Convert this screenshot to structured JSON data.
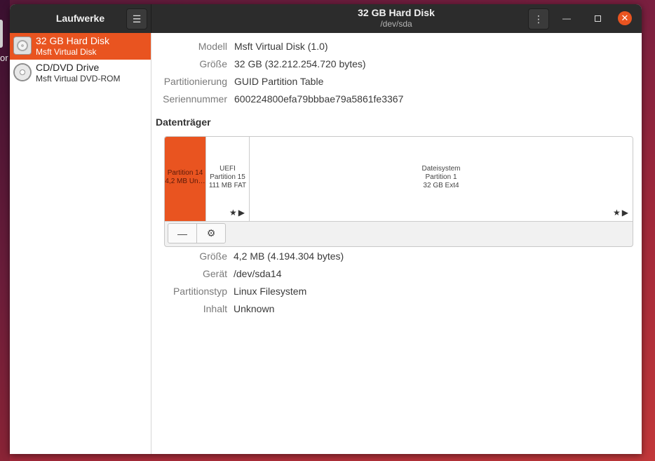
{
  "desktop": {
    "left_text": "or"
  },
  "sidebar": {
    "title": "Laufwerke",
    "devices": [
      {
        "name": "32 GB Hard Disk",
        "sub": "Msft Virtual Disk",
        "icon": "hard-disk-icon",
        "selected": true
      },
      {
        "name": "CD/DVD Drive",
        "sub": "Msft Virtual DVD-ROM",
        "icon": "optical-disc-icon",
        "selected": false
      }
    ]
  },
  "header": {
    "title": "32 GB Hard Disk",
    "subtitle": "/dev/sda",
    "menu_icon": "hamburger-menu-icon",
    "kebab_icon": "vertical-dots-icon",
    "minimize_icon": "minimize-icon",
    "maximize_icon": "maximize-icon",
    "close_icon": "close-icon"
  },
  "disk": {
    "model_label": "Modell",
    "model_value": "Msft Virtual Disk (1.0)",
    "size_label": "Größe",
    "size_value": "32 GB (32.212.254.720 bytes)",
    "partitioning_label": "Partitionierung",
    "partitioning_value": "GUID Partition Table",
    "serial_label": "Seriennummer",
    "serial_value": "600224800efa79bbbae79a5861fe3367"
  },
  "volumes": {
    "section_title": "Datenträger",
    "partitions": [
      {
        "line1": "Partition 14",
        "line2": "4,2 MB Un…",
        "line3": "",
        "selected": true
      },
      {
        "line1": "UEFI",
        "line2": "Partition 15",
        "line3": "111 MB FAT",
        "selected": false
      },
      {
        "line1": "Dateisystem",
        "line2": "Partition 1",
        "line3": "32 GB Ext4",
        "selected": false
      }
    ],
    "toolbar": {
      "remove_label": "—",
      "settings_icon": "gears-icon"
    }
  },
  "partition_details": {
    "size_label": "Größe",
    "size_value": "4,2 MB (4.194.304 bytes)",
    "device_label": "Gerät",
    "device_value": "/dev/sda14",
    "type_label": "Partitionstyp",
    "type_value": "Linux Filesystem",
    "content_label": "Inhalt",
    "content_value": "Unknown"
  },
  "colors": {
    "accent": "#e95420",
    "headerbar": "#2c2c2c"
  }
}
